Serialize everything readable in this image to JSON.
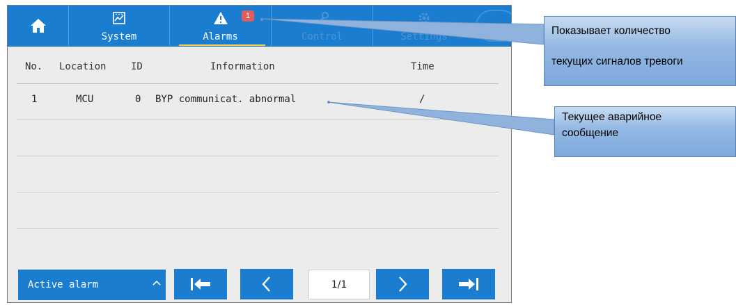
{
  "nav": {
    "tabs": [
      {
        "label": ""
      },
      {
        "label": "System"
      },
      {
        "label": "Alarms"
      },
      {
        "label": "Control"
      },
      {
        "label": "Settings"
      }
    ],
    "alarm_count": "1"
  },
  "table": {
    "headers": [
      "No.",
      "Location",
      "ID",
      "Information",
      "Time"
    ],
    "rows": [
      {
        "no": "1",
        "location": "MCU",
        "id": "0",
        "information": "BYP communicat. abnormal",
        "time": "/"
      }
    ]
  },
  "footer": {
    "active_alarm_label": "Active alarm",
    "page": "1/1"
  },
  "callouts": {
    "count_line1": "Показывает количество",
    "count_line2": "текущих сигналов тревоги",
    "current_line1": "Текущее аварийное",
    "current_line2": "сообщение"
  },
  "colors": {
    "accent": "#1b7dd0",
    "badge": "#e35b5b",
    "tab_underline": "#f4d24a",
    "callout": "#93b8e3"
  }
}
